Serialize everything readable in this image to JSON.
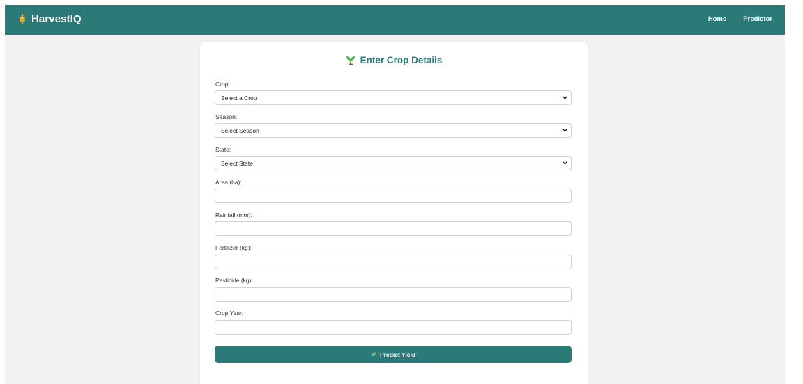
{
  "navbar": {
    "brand": "HarvestIQ",
    "brand_icon": "wheat-icon",
    "links": [
      {
        "label": "Home"
      },
      {
        "label": "Predictor"
      }
    ]
  },
  "form": {
    "title": "Enter Crop Details",
    "title_icon": "sprout-icon",
    "fields": [
      {
        "label": "Crop:",
        "type": "select",
        "value": "Select a Crop"
      },
      {
        "label": "Season:",
        "type": "select",
        "value": "Select Season"
      },
      {
        "label": "State:",
        "type": "select",
        "value": "Select State"
      },
      {
        "label": "Area (ha):",
        "type": "input",
        "value": ""
      },
      {
        "label": "Rainfall (mm):",
        "type": "input",
        "value": ""
      },
      {
        "label": "Fertilizer (kg):",
        "type": "input",
        "value": ""
      },
      {
        "label": "Pesticide (kg):",
        "type": "input",
        "value": ""
      },
      {
        "label": "Crop Year:",
        "type": "input",
        "value": ""
      }
    ],
    "submit": {
      "label": "Predict Yield",
      "icon": "leaf-icon"
    }
  },
  "colors": {
    "primary": "#2b7a78",
    "background": "#f2f2f2",
    "card": "#ffffff"
  }
}
